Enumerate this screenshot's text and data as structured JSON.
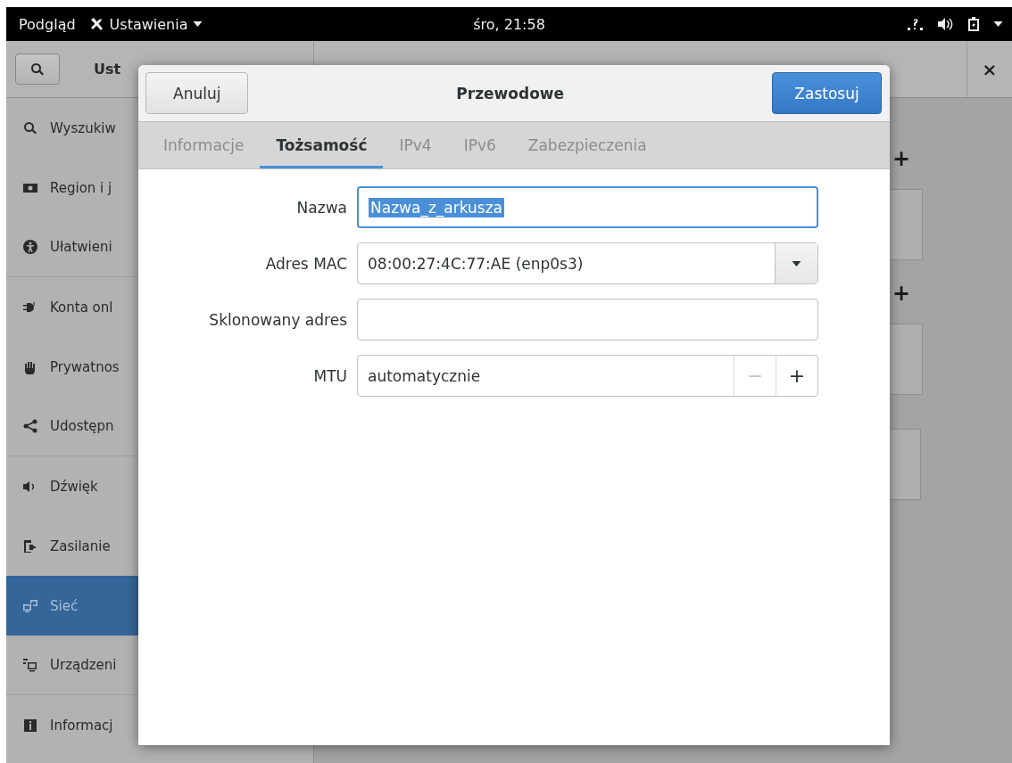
{
  "top_bar": {
    "activities": "Podgląd",
    "app_menu": "Ustawienia",
    "clock": "śro, 21:58"
  },
  "settings_window": {
    "title": "Ust",
    "close": "×",
    "sidebar": [
      {
        "label": "Wyszukiw",
        "selected": false,
        "separator_after": false
      },
      {
        "label": "Region i j",
        "selected": false,
        "separator_after": false
      },
      {
        "label": "Ułatwieni",
        "selected": false,
        "separator_after": true
      },
      {
        "label": "Konta onl",
        "selected": false,
        "separator_after": false
      },
      {
        "label": "Prywatnos",
        "selected": false,
        "separator_after": false
      },
      {
        "label": "Udostępn",
        "selected": false,
        "separator_after": true
      },
      {
        "label": "Dźwięk",
        "selected": false,
        "separator_after": false
      },
      {
        "label": "Zasilanie",
        "selected": false,
        "separator_after": false
      },
      {
        "label": "Sieć",
        "selected": true,
        "separator_after": false
      },
      {
        "label": "Urządzeni",
        "selected": false,
        "separator_after": true
      },
      {
        "label": "Informacj",
        "selected": false,
        "separator_after": false
      }
    ],
    "sections": [
      {
        "add": "+"
      },
      {
        "add": "+"
      }
    ]
  },
  "dialog": {
    "title": "Przewodowe",
    "cancel": "Anuluj",
    "apply": "Zastosuj",
    "tabs": [
      {
        "label": "Informacje",
        "selected": false
      },
      {
        "label": "Tożsamość",
        "selected": true
      },
      {
        "label": "IPv4",
        "selected": false
      },
      {
        "label": "IPv6",
        "selected": false
      },
      {
        "label": "Zabezpieczenia",
        "selected": false
      }
    ],
    "fields": [
      {
        "kind": "entry",
        "label": "Nazwa",
        "value": "Nazwa_z_arkusza",
        "focused": true
      },
      {
        "kind": "combo",
        "label": "Adres MAC",
        "value": "08:00:27:4C:77:AE (enp0s3)"
      },
      {
        "kind": "entry",
        "label": "Sklonowany adres",
        "focused": false
      },
      {
        "kind": "spin",
        "label": "MTU",
        "value": "automatycznie",
        "minus": "−",
        "plus": "+",
        "minus_disabled": true
      }
    ]
  }
}
